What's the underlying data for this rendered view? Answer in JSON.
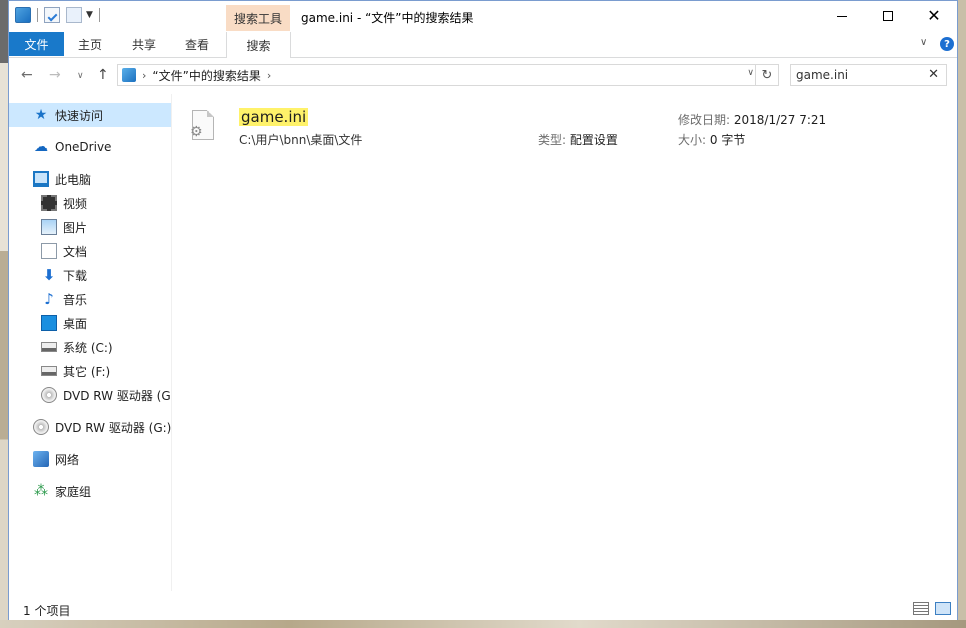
{
  "window": {
    "title": "game.ini - “文件”中的搜索结果",
    "contextual_tab_group": "搜索工具"
  },
  "ribbon": {
    "tabs": [
      {
        "label": "文件"
      },
      {
        "label": "主页"
      },
      {
        "label": "共享"
      },
      {
        "label": "查看"
      },
      {
        "label": "搜索"
      }
    ]
  },
  "address": {
    "breadcrumb": "“文件”中的搜索结果"
  },
  "search": {
    "value": "game.ini"
  },
  "navpane": {
    "items": [
      {
        "label": "快速访问",
        "icon": "quick-access-star-icon"
      },
      {
        "label": "OneDrive",
        "icon": "onedrive-cloud-icon"
      },
      {
        "label": "此电脑",
        "icon": "this-pc-icon"
      },
      {
        "label": "视频",
        "icon": "videos-folder-icon"
      },
      {
        "label": "图片",
        "icon": "pictures-folder-icon"
      },
      {
        "label": "文档",
        "icon": "documents-folder-icon"
      },
      {
        "label": "下载",
        "icon": "downloads-arrow-icon"
      },
      {
        "label": "音乐",
        "icon": "music-note-icon"
      },
      {
        "label": "桌面",
        "icon": "desktop-folder-icon"
      },
      {
        "label": "系统 (C:)",
        "icon": "system-drive-icon"
      },
      {
        "label": "其它 (F:)",
        "icon": "drive-icon"
      },
      {
        "label": "DVD RW 驱动器 (G:)",
        "icon": "dvd-drive-icon"
      },
      {
        "label": "DVD RW 驱动器 (G:)",
        "icon": "dvd-drive-icon"
      },
      {
        "label": "网络",
        "icon": "network-icon"
      },
      {
        "label": "家庭组",
        "icon": "homegroup-icon"
      }
    ]
  },
  "results": [
    {
      "name": "game.ini",
      "path": "C:\\用户\\bnn\\桌面\\文件",
      "type_label": "类型:",
      "type": "配置设置",
      "date_label": "修改日期:",
      "date": "2018/1/27 7:21",
      "size_label": "大小:",
      "size": "0 字节"
    }
  ],
  "status": {
    "count": "1 个项目"
  },
  "colors": {
    "file_tab": "#1979ca",
    "search_tools_tab": "#f9dcc5",
    "selection": "#cce8ff",
    "search_highlight": "#fff26a"
  }
}
